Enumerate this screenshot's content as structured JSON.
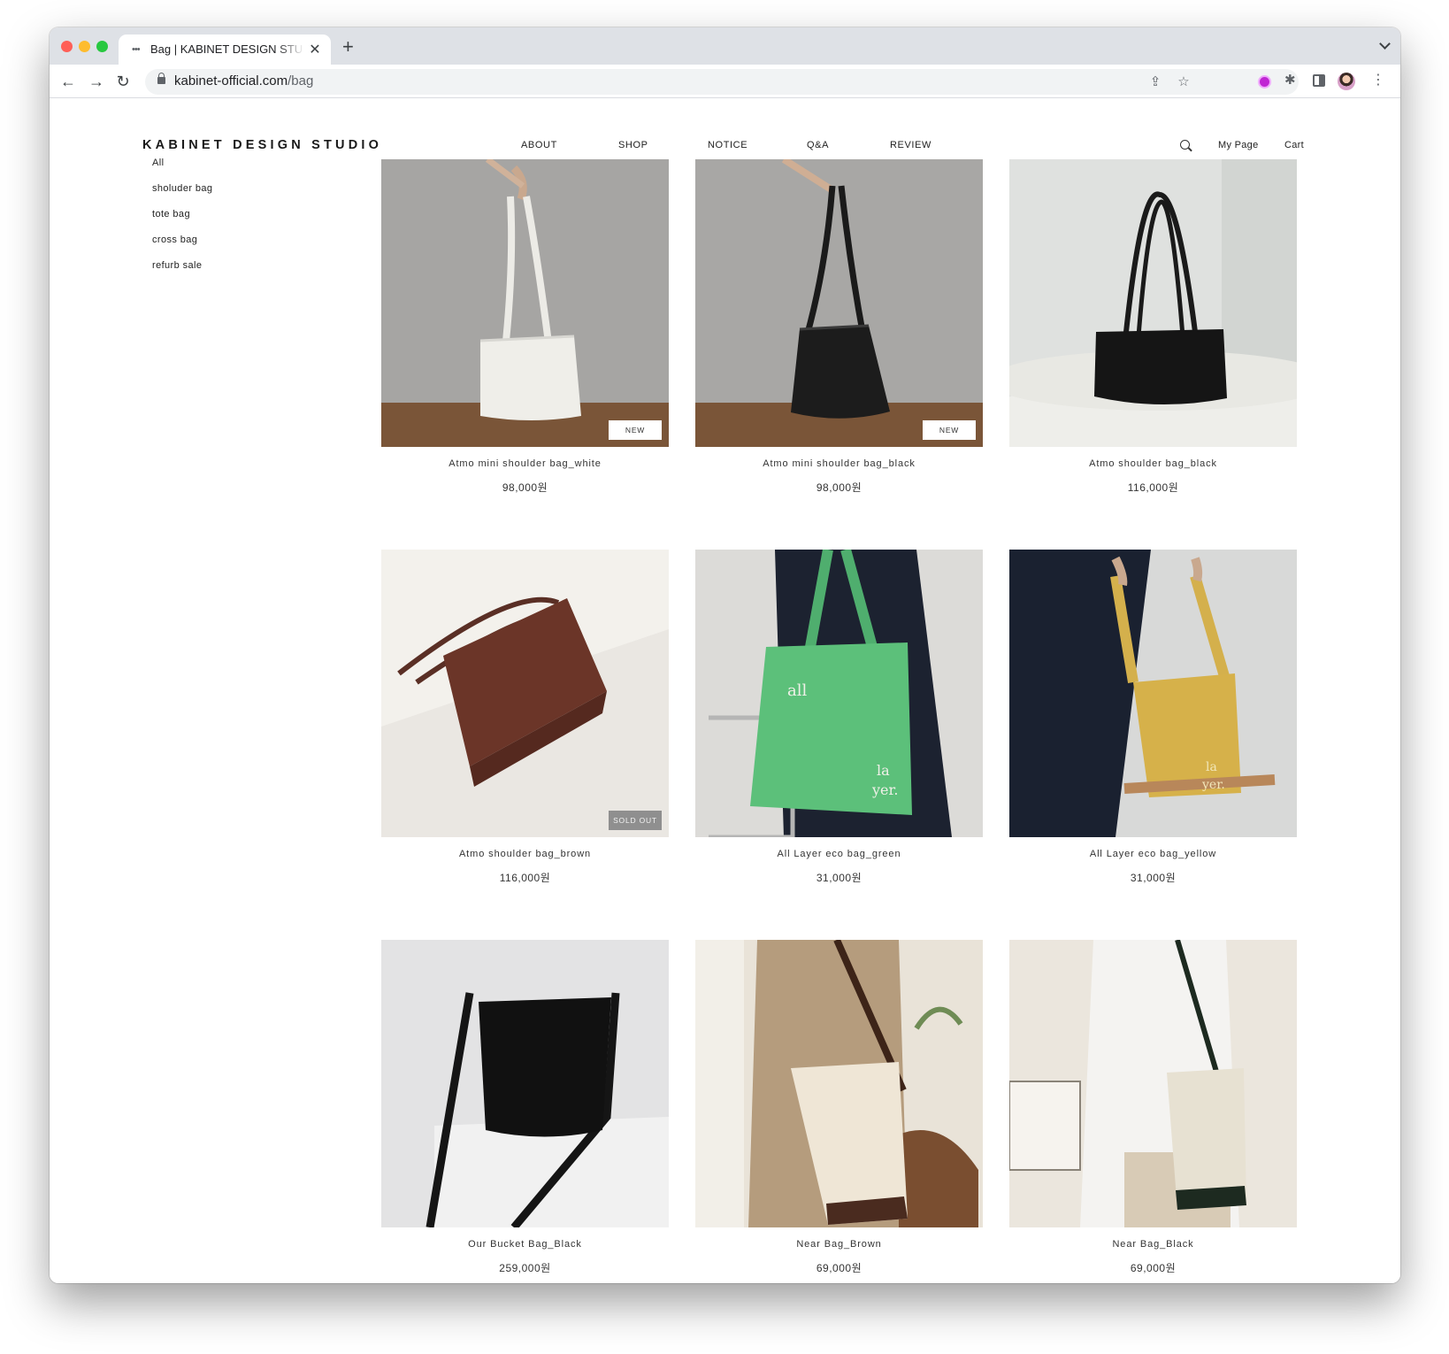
{
  "browser": {
    "tab_title": "Bag | KABINET DESIGN STUDIO",
    "url_host": "kabinet-official.com",
    "url_path": "/bag"
  },
  "site": {
    "logo": "KABINET DESIGN STUDIO",
    "nav": [
      "ABOUT",
      "SHOP",
      "NOTICE",
      "Q&A",
      "REVIEW"
    ],
    "user_nav": {
      "my_page": "My Page",
      "cart": "Cart"
    }
  },
  "sidebar": {
    "categories": [
      "All",
      "sholuder bag",
      "tote bag",
      "cross bag",
      "refurb sale"
    ]
  },
  "products": [
    {
      "name": "Atmo mini shoulder bag_white",
      "price": "98,000원",
      "badge": "NEW"
    },
    {
      "name": "Atmo mini shoulder bag_black",
      "price": "98,000원",
      "badge": "NEW"
    },
    {
      "name": "Atmo shoulder bag_black",
      "price": "116,000원"
    },
    {
      "name": "Atmo shoulder bag_brown",
      "price": "116,000원",
      "badge": "SOLD OUT"
    },
    {
      "name": "All Layer eco bag_green",
      "price": "31,000원"
    },
    {
      "name": "All Layer eco bag_yellow",
      "price": "31,000원"
    },
    {
      "name": "Our Bucket Bag_Black",
      "price": "259,000원"
    },
    {
      "name": "Near Bag_Brown",
      "price": "69,000원"
    },
    {
      "name": "Near Bag_Black",
      "price": "69,000원"
    }
  ],
  "theme": {
    "text": "#222222",
    "badge_sold": "#8f8f8f"
  },
  "icons": [
    "back-arrow-icon",
    "forward-arrow-icon",
    "reload-icon",
    "lock-icon",
    "share-icon",
    "star-icon",
    "puzzle-icon",
    "side-panel-icon",
    "kebab-menu-icon",
    "search-icon",
    "close-icon",
    "plus-icon"
  ]
}
